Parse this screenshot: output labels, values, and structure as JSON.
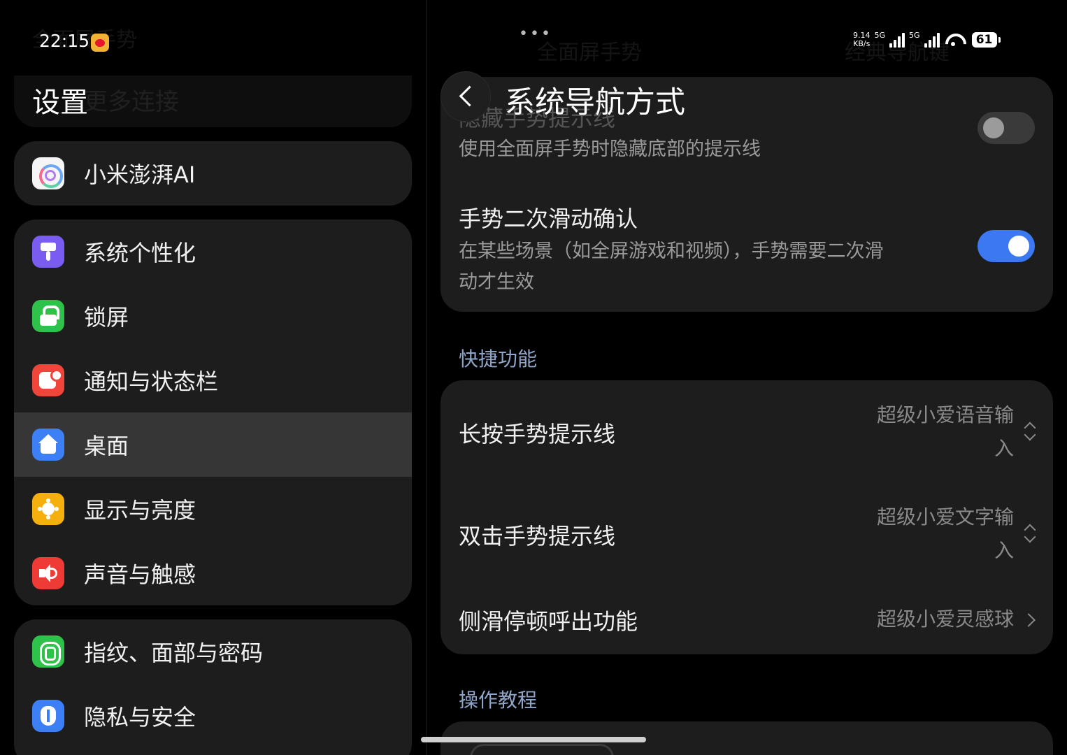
{
  "status_bar": {
    "time": "22:15",
    "net_speed": "9.14",
    "net_speed_unit": "KB/s",
    "sim1_type": "5G",
    "sim2_type": "5G",
    "battery": "61"
  },
  "left_panel": {
    "title": "设置",
    "faded_behind_title": "更多连接",
    "faded_behind_top": "全面屏手势",
    "groups": [
      {
        "items": [
          {
            "label": "小米澎湃AI",
            "icon": "hyperos-ai-icon"
          }
        ]
      },
      {
        "items": [
          {
            "label": "系统个性化",
            "icon": "personalization-icon"
          },
          {
            "label": "锁屏",
            "icon": "lock-icon"
          },
          {
            "label": "通知与状态栏",
            "icon": "notification-icon"
          },
          {
            "label": "桌面",
            "icon": "home-icon",
            "selected": true
          },
          {
            "label": "显示与亮度",
            "icon": "sun-icon"
          },
          {
            "label": "声音与触感",
            "icon": "speaker-icon"
          }
        ]
      },
      {
        "items": [
          {
            "label": "指纹、面部与密码",
            "icon": "fingerprint-icon"
          },
          {
            "label": "隐私与安全",
            "icon": "privacy-shield-icon"
          }
        ]
      }
    ]
  },
  "right_panel": {
    "title": "系统导航方式",
    "faded_behind_top": "全面屏手势",
    "faded_behind_top_right": "经典导航键",
    "settings_card": {
      "hide_hint": {
        "title": "隐藏手势提示线",
        "desc": "使用全面屏手势时隐藏底部的提示线",
        "enabled": false
      },
      "double_swipe": {
        "title": "手势二次滑动确认",
        "desc_line1": "在某些场景（如全屏游戏和视频），手势需要二次滑",
        "desc_line2": "动才生效",
        "enabled": true
      }
    },
    "quick_section": {
      "header": "快捷功能",
      "items": [
        {
          "title": "长按手势提示线",
          "value_line1": "超级小爱语音输",
          "value_line2": "入"
        },
        {
          "title": "双击手势提示线",
          "value_line1": "超级小爱文字输",
          "value_line2": "入"
        },
        {
          "title": "侧滑停顿呼出功能",
          "value_line1": "超级小爱灵感球"
        }
      ]
    },
    "tutorial_section": {
      "header": "操作教程"
    }
  },
  "colors": {
    "accent": "#3b78f2",
    "card": "#1d1d1d",
    "selected_row": "#363636",
    "section_header": "#8fa6c8"
  }
}
